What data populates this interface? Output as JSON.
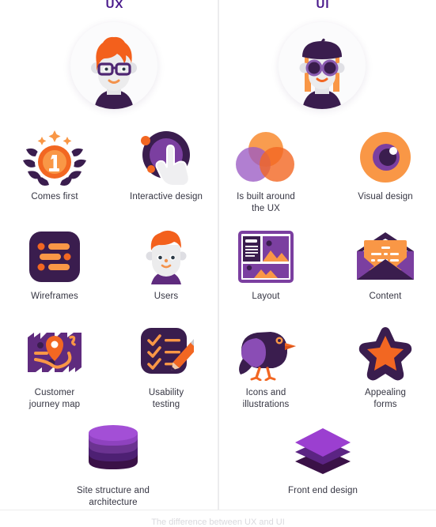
{
  "headers": {
    "left": "UX",
    "right": "UI"
  },
  "colors": {
    "purple_dark": "#3B1E४5",
    "purple_deep": "#3a1d4e",
    "purple_mid": "#7b3fa0",
    "purple_light": "#9b5bc4",
    "orange": "#f26722",
    "orange_light": "#f99746",
    "heading": "#4a1a8c",
    "label": "#353542",
    "divider": "#ececee",
    "background": "#ffffff"
  },
  "avatars": {
    "ux": {
      "name": "ux-avatar",
      "description": "person with orange hair and purple eyeglasses"
    },
    "ui": {
      "name": "ui-avatar",
      "description": "person with purple beret, orange hair and purple sunglasses"
    }
  },
  "ux_items": [
    {
      "icon": "medal-icon",
      "label": "Comes first"
    },
    {
      "icon": "pointing-hand-icon",
      "label": "Interactive design"
    },
    {
      "icon": "wireframe-icon",
      "label": "Wireframes"
    },
    {
      "icon": "user-face-icon",
      "label": "Users"
    },
    {
      "icon": "map-pin-icon",
      "label": "Customer\njourney map"
    },
    {
      "icon": "checklist-pencil-icon",
      "label": "Usability\ntesting"
    },
    {
      "icon": "database-stack-icon",
      "label": "Site structure and\narchitecture"
    }
  ],
  "ui_items": [
    {
      "icon": "venn-circles-icon",
      "label": "Is built around\nthe UX"
    },
    {
      "icon": "eye-icon",
      "label": "Visual design"
    },
    {
      "icon": "layout-grid-icon",
      "label": "Layout"
    },
    {
      "icon": "open-envelope-icon",
      "label": "Content"
    },
    {
      "icon": "bird-icon",
      "label": "Icons and\nillustrations"
    },
    {
      "icon": "star-icon",
      "label": "Appealing\nforms"
    },
    {
      "icon": "layers-icon",
      "label": "Front end design"
    }
  ],
  "footer": {
    "caption": "The difference between UX and UI"
  }
}
